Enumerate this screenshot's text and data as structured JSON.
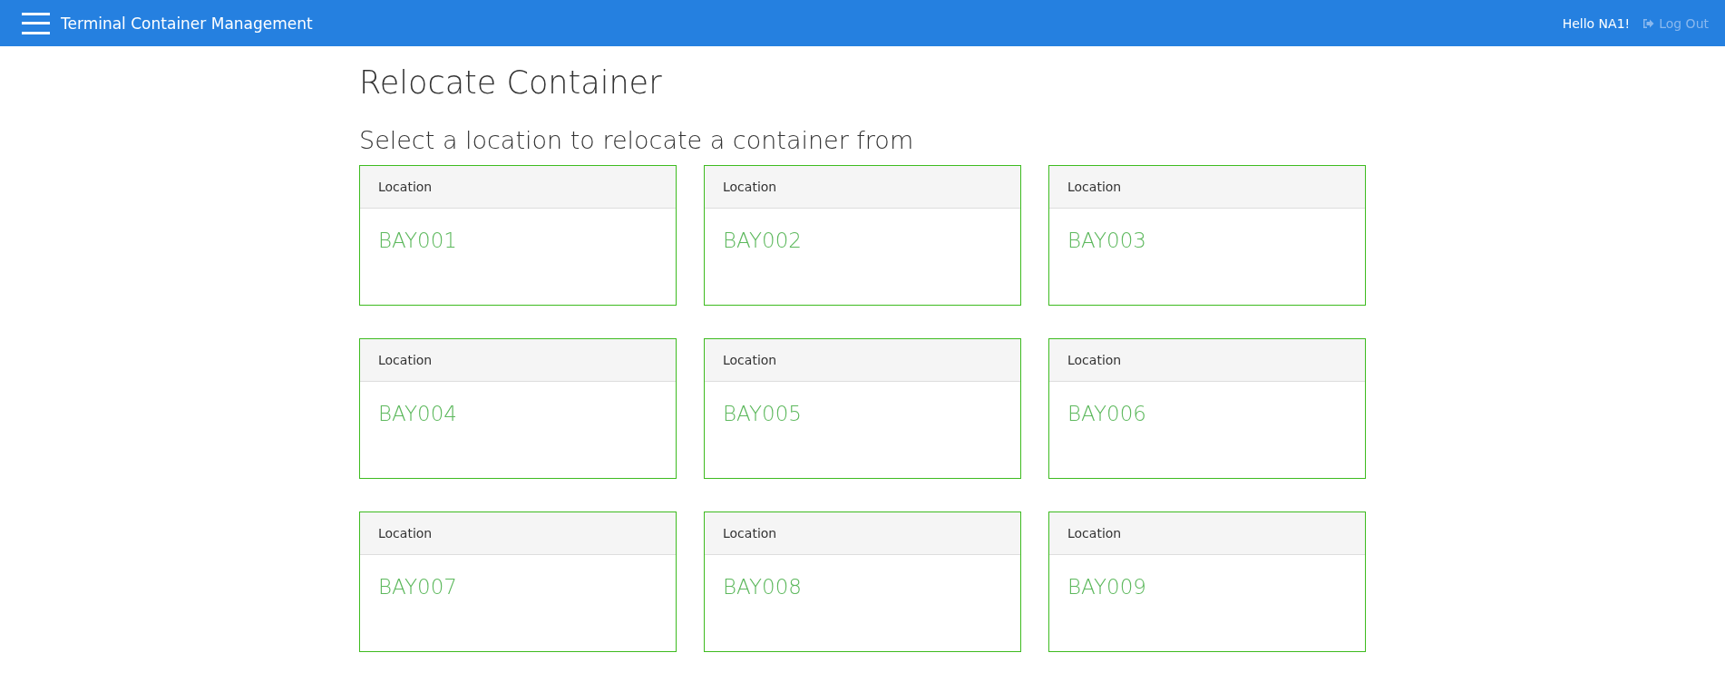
{
  "navbar": {
    "title": "Terminal Container Management",
    "greeting": "Hello NA1!",
    "logout": "Log Out"
  },
  "page": {
    "title": "Relocate Container",
    "subtitle": "Select a location to relocate a container from"
  },
  "locations": [
    {
      "header": "Location",
      "name": "BAY001"
    },
    {
      "header": "Location",
      "name": "BAY002"
    },
    {
      "header": "Location",
      "name": "BAY003"
    },
    {
      "header": "Location",
      "name": "BAY004"
    },
    {
      "header": "Location",
      "name": "BAY005"
    },
    {
      "header": "Location",
      "name": "BAY006"
    },
    {
      "header": "Location",
      "name": "BAY007"
    },
    {
      "header": "Location",
      "name": "BAY008"
    },
    {
      "header": "Location",
      "name": "BAY009"
    }
  ]
}
